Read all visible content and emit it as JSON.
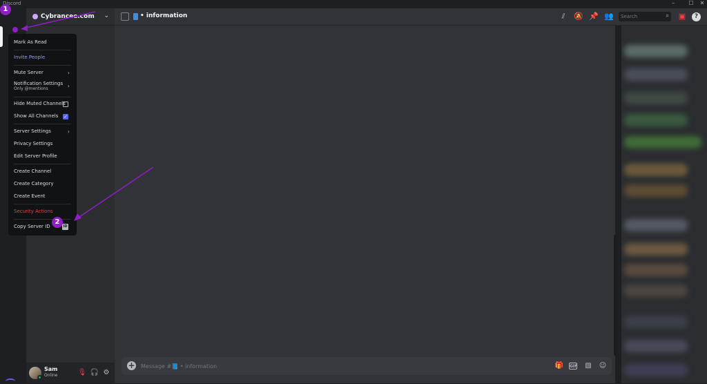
{
  "window": {
    "app_name": "Discord",
    "minimize": "–",
    "maximize": "☐",
    "close": "✕"
  },
  "server": {
    "name": "Cybrancee.com"
  },
  "channel": {
    "name": "• information"
  },
  "search": {
    "placeholder": "Search"
  },
  "context_menu": {
    "items": [
      {
        "label": "Mark As Read"
      },
      {
        "label": "Invite People"
      },
      {
        "label": "Mute Server"
      },
      {
        "label": "Notification Settings",
        "sublabel": "Only @mentions"
      },
      {
        "label": "Hide Muted Channels"
      },
      {
        "label": "Show All Channels"
      },
      {
        "label": "Server Settings"
      },
      {
        "label": "Privacy Settings"
      },
      {
        "label": "Edit Server Profile"
      },
      {
        "label": "Create Channel"
      },
      {
        "label": "Create Category"
      },
      {
        "label": "Create Event"
      },
      {
        "label": "Security Actions"
      },
      {
        "label": "Copy Server ID",
        "badge": "ID"
      }
    ]
  },
  "user": {
    "name": "Sam",
    "status": "Online"
  },
  "composer": {
    "placeholder": "Message #📘 • information",
    "gif": "GIF"
  },
  "annotations": {
    "marker1": "1",
    "marker2": "2"
  },
  "colors": {
    "accent": "#5865f2",
    "danger": "#f23f42",
    "annotation": "#8f1ec4"
  }
}
